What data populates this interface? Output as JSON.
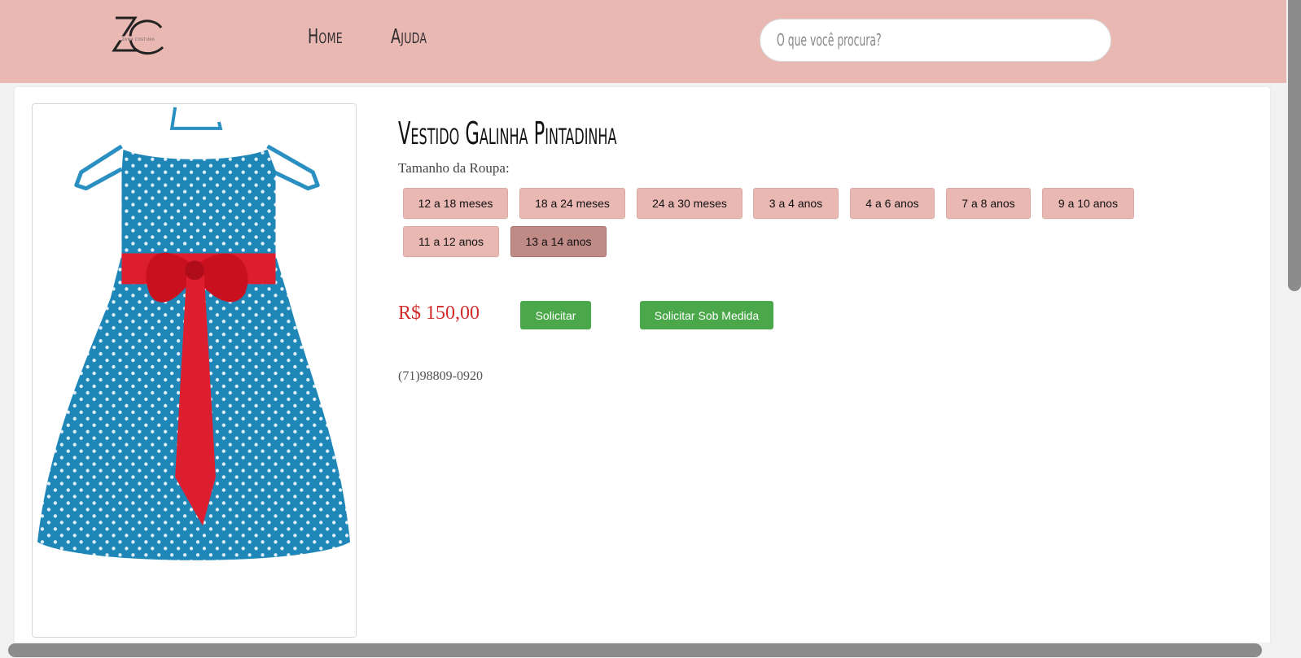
{
  "header": {
    "logo_text": "ZANA COSTURA",
    "nav": [
      {
        "label": "Home"
      },
      {
        "label": "Ajuda"
      }
    ],
    "search": {
      "placeholder": "O que você procura?"
    }
  },
  "product": {
    "image_alt": "Vestido Galinha Pintadinha",
    "title": "Vestido Galinha Pintadinha",
    "size_label": "Tamanho da Roupa:",
    "sizes": [
      {
        "label": "12 a 18 meses",
        "selected": false
      },
      {
        "label": "18 a 24 meses",
        "selected": false
      },
      {
        "label": "24 a 30 meses",
        "selected": false
      },
      {
        "label": "3 a 4 anos",
        "selected": false
      },
      {
        "label": "4 a 6 anos",
        "selected": false
      },
      {
        "label": "7 a 8 anos",
        "selected": false
      },
      {
        "label": "9 a 10 anos",
        "selected": false
      },
      {
        "label": "11 a 12 anos",
        "selected": false
      },
      {
        "label": "13 a 14 anos",
        "selected": true
      }
    ],
    "price": "R$ 150,00",
    "request_button": "Solicitar",
    "custom_request_button": "Solicitar Sob Medida",
    "phone": "(71)98809-0920"
  },
  "colors": {
    "header_bg": "#e9b8b3",
    "size_button": "#e9b8b3",
    "size_button_selected": "#c08a86",
    "price": "#d22b2b",
    "action_button": "#4aa84a",
    "dress_blue": "#1f86b8",
    "bow_red": "#dd1e2e"
  }
}
